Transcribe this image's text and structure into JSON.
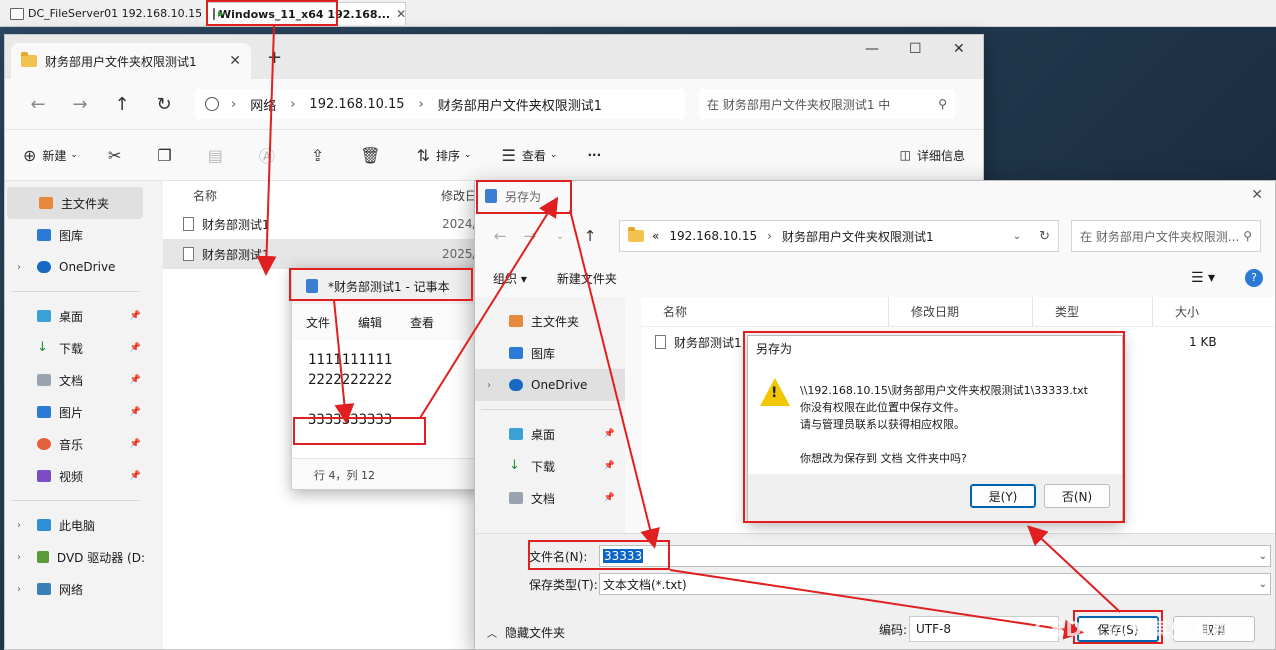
{
  "vm_tabs": [
    {
      "label": "DC_FileServer01 192.168.10.15"
    },
    {
      "label": "Windows_11_x64 192.168..."
    }
  ],
  "explorer": {
    "tab_title": "财务部用户文件夹权限测试1",
    "breadcrumb": [
      "网络",
      "192.168.10.15",
      "财务部用户文件夹权限测试1"
    ],
    "search_placeholder": "在 财务部用户文件夹权限测试1 中",
    "commands": {
      "new": "新建",
      "sort": "排序",
      "view": "查看",
      "more": "···",
      "details": "详细信息"
    },
    "sidebar": [
      {
        "label": "主文件夹",
        "icon": "home-icon"
      },
      {
        "label": "图库",
        "icon": "gallery-icon"
      },
      {
        "label": "OneDrive",
        "icon": "cloud-icon"
      },
      {
        "label": "桌面",
        "icon": "desktop-icon"
      },
      {
        "label": "下载",
        "icon": "download-icon"
      },
      {
        "label": "文档",
        "icon": "documents-icon"
      },
      {
        "label": "图片",
        "icon": "pictures-icon"
      },
      {
        "label": "音乐",
        "icon": "music-icon"
      },
      {
        "label": "视频",
        "icon": "video-icon"
      },
      {
        "label": "此电脑",
        "icon": "computer-icon"
      },
      {
        "label": "DVD 驱动器 (D:",
        "icon": "dvd-icon"
      },
      {
        "label": "网络",
        "icon": "network-icon"
      }
    ],
    "columns": {
      "name": "名称",
      "modified": "修改日"
    },
    "files": [
      {
        "name": "财务部测试1",
        "date": "2024/"
      },
      {
        "name": "财务部测试1",
        "date": "2025/"
      }
    ]
  },
  "notepad": {
    "title": "*财务部测试1 - 记事本",
    "menu": [
      "文件",
      "编辑",
      "查看"
    ],
    "lines": [
      "1111111111",
      "2222222222",
      "",
      "3333333333"
    ],
    "status": "行 4，列 12"
  },
  "saveas": {
    "title": "另存为",
    "breadcrumb_prefix": "«",
    "breadcrumb": [
      "192.168.10.15",
      "财务部用户文件夹权限测试1"
    ],
    "search_placeholder": "在 财务部用户文件夹权限测...",
    "toolbar": {
      "organize": "组织 ▾",
      "new_folder": "新建文件夹"
    },
    "sidebar": [
      {
        "label": "主文件夹"
      },
      {
        "label": "图库"
      },
      {
        "label": "OneDrive"
      },
      {
        "label": "桌面"
      },
      {
        "label": "下载"
      },
      {
        "label": "文档"
      }
    ],
    "columns": {
      "name": "名称",
      "modified": "修改日期",
      "type": "类型",
      "size": "大小"
    },
    "file": {
      "name": "财务部测试1",
      "size": "1 KB"
    },
    "filename_label": "文件名(N):",
    "filename_value": "33333",
    "filetype_label": "保存类型(T):",
    "filetype_value": "文本文档(*.txt)",
    "hide_folders": "隐藏文件夹",
    "encoding_label": "编码:",
    "encoding_value": "UTF-8",
    "save_button": "保存(S)",
    "cancel_button": "取消"
  },
  "error_dialog": {
    "title": "另存为",
    "message_lines": [
      "\\\\192.168.10.15\\财务部用户文件夹权限测试1\\33333.txt",
      "你没有权限在此位置中保存文件。",
      "请与管理员联系以获得相应权限。",
      "",
      "你想改为保存到 文档 文件夹中吗?"
    ],
    "yes_button": "是(Y)",
    "no_button": "否(N)"
  },
  "watermark": "CSDN @知其知真所以",
  "colors": {
    "annotation_red": "#e02020",
    "selection_blue": "#0a64c8",
    "accent": "#0063b1"
  }
}
